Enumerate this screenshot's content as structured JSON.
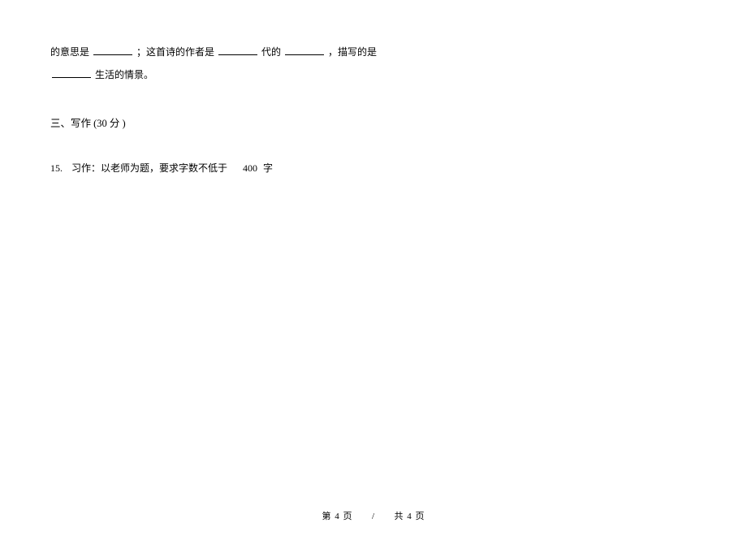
{
  "fragment": {
    "line1_part1": "的意思是",
    "line1_part2": "；这首诗的作者是",
    "line1_part3": "代的",
    "line1_part4": "，描写的是",
    "line2_part1": "生活的情景。"
  },
  "section": {
    "heading": "三、写作 (30 分 )"
  },
  "question": {
    "number": "15.",
    "text_part1": "习作：以老师为题，要求字数不低于",
    "word_count": "400",
    "text_part2": "字"
  },
  "footer": {
    "left": "第 4 页",
    "separator": "/",
    "right": "共 4 页"
  }
}
